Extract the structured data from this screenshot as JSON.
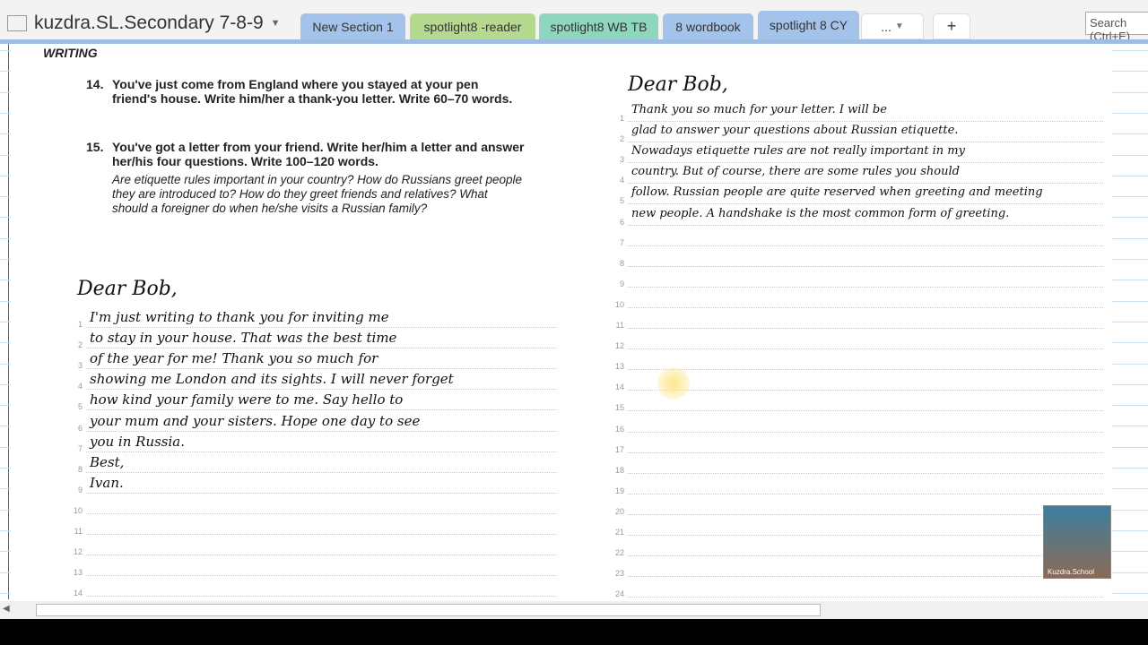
{
  "notebook": {
    "title": "kuzdra.SL.Secondary 7-8-9"
  },
  "tabs": [
    {
      "label": "New Section 1",
      "color": "#a4c3ea"
    },
    {
      "label": "spotlight8 -reader",
      "color": "#b5d98f"
    },
    {
      "label": "spotlight8 WB TB",
      "color": "#8fd6c0"
    },
    {
      "label": "8 wordbook",
      "color": "#a4c3ea"
    },
    {
      "label": "spotlight 8 CY",
      "color": "#a4c3ea"
    },
    {
      "label": "..."
    },
    {
      "label": "+"
    }
  ],
  "search": {
    "placeholder": "Search (Ctrl+E)"
  },
  "textbook": {
    "heading": "WRITING",
    "task14": {
      "num": "14.",
      "text": "You've just come from England where you stayed at your pen friend's house. Write him/her a thank-you letter.  Write 60–70 words."
    },
    "task15": {
      "num": "15.",
      "text": "You've got a letter from your friend. Write her/him a letter and answer her/his four questions. Write 100–120 words.",
      "questions": "Are etiquette rules important in your country? How do Russians greet people they are introduced to? How do they greet friends and relatives? What should a foreigner do when he/she visits a Russian family?"
    }
  },
  "letter1": {
    "greeting": "Dear Bob,",
    "lines": [
      "I'm just writing to thank you for inviting me",
      "to stay in your house. That was the best time",
      "of the year for me! Thank you so much for",
      "showing me London and its sights. I will never forget",
      "how kind your family were to me. Say hello to",
      "your mum and your sisters. Hope one day to see",
      "you in Russia.",
      "Best,",
      "Ivan."
    ]
  },
  "letter2": {
    "greeting": "Dear Bob,",
    "lines": [
      "Thank you so much for your letter. I will be",
      "glad to answer your questions about Russian etiquette.",
      "Nowadays etiquette rules are not really important in my",
      "country. But of course, there are some rules you should",
      "follow. Russian people are quite reserved when greeting and meeting",
      "new people. A handshake is the most common form of greeting."
    ]
  },
  "webcam": {
    "watermark": "Kuzdra.School"
  }
}
